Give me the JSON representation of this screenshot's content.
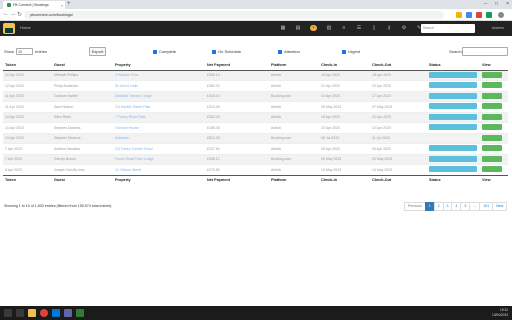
{
  "browser": {
    "tab_title": "FB Connect | Bookings",
    "url": "pbconnect.com/bookings/"
  },
  "app": {
    "home_label": "Home",
    "search_placeholder": "Search",
    "user_label": "Andrew"
  },
  "controls": {
    "show_label": "Show",
    "entries_value": "10",
    "entries_label": "entries",
    "export_label": "Export",
    "filters": [
      "Complete",
      "On Schedule",
      "Attention",
      "Urgent"
    ],
    "search_label": "Search:"
  },
  "table": {
    "columns": [
      "Token",
      "Guest",
      "Property",
      "Net Payment",
      "Platform",
      "Check-In",
      "Check-Out",
      "Status",
      "View"
    ],
    "rows": [
      [
        "12 Apr 2023",
        "Michael Phillips",
        "2 Heddon Row",
        "£356.10",
        "Airbnb",
        "15 Apr 2023",
        "18 Apr 2023",
        "blue",
        "green"
      ],
      [
        "12 Apr 2023",
        "Philip Anderson",
        "St John's Halls",
        "£284.22",
        "Airbnb",
        "21 Apr 2023",
        "23 Apr 2023",
        "blue",
        "green"
      ],
      [
        "11 Apr 2023",
        "Graham Hallett",
        "Eastside Terrace Lodge",
        "£418.10",
        "Booking.com",
        "14 Apr 2023",
        "17 Apr 2023",
        "blue",
        "green"
      ],
      [
        "11 Apr 2023",
        "Sara Nelson",
        "2/3 Market Street Flats",
        "£215.40",
        "Airbnb",
        "05 May 2023",
        "07 May 2023",
        "blue",
        "green"
      ],
      [
        "10 Apr 2023",
        "Ellen Rees",
        "7 Farley Road Flats",
        "£302.00",
        "Airbnb",
        "18 Apr 2023",
        "21 Apr 2023",
        "blue",
        "green"
      ],
      [
        "10 Apr 2023",
        "Stephen Dickens",
        "Orchard House",
        "£189.45",
        "Airbnb",
        "10 Apr 2023",
        "12 Apr 2023",
        "blue",
        "green"
      ],
      [
        "10 Apr 2023",
        "Stephen Dickens",
        "Ashdown",
        "£512.30",
        "Booking.com",
        "08 Jul 2023",
        "11 Jul 2023",
        "grey",
        "green"
      ],
      [
        "7 Apr 2023",
        "Andrew Hawkins",
        "2/3 Farley Garden Road",
        "£247.60",
        "Airbnb",
        "28 Apr 2023",
        "30 Apr 2023",
        "blue",
        "green"
      ],
      [
        "7 Apr 2023",
        "Glenys Brown",
        "Foxes Road Town Lodge",
        "£398.12",
        "Booking.com",
        "20 May 2023",
        "24 May 2023",
        "blue",
        "green"
      ],
      [
        "6 Apr 2023",
        "Joseph Scruffy Ives",
        "10 Ohlson Street",
        "£276.80",
        "Airbnb",
        "12 May 2023",
        "14 May 2023",
        "blue",
        "green"
      ]
    ]
  },
  "footer": {
    "info": "Showing 1 to 10 of 1,503 entries (filtered from 159,574 total entries)",
    "pages": [
      "Previous",
      "1",
      "2",
      "3",
      "4",
      "5",
      "...",
      "151",
      "Next"
    ]
  },
  "taskbar": {
    "time": "19:32",
    "date": "13/04/2023"
  },
  "colors": {
    "status_blue": "#5bc0de",
    "view_green": "#5cb85c",
    "appbar": "#222222"
  }
}
